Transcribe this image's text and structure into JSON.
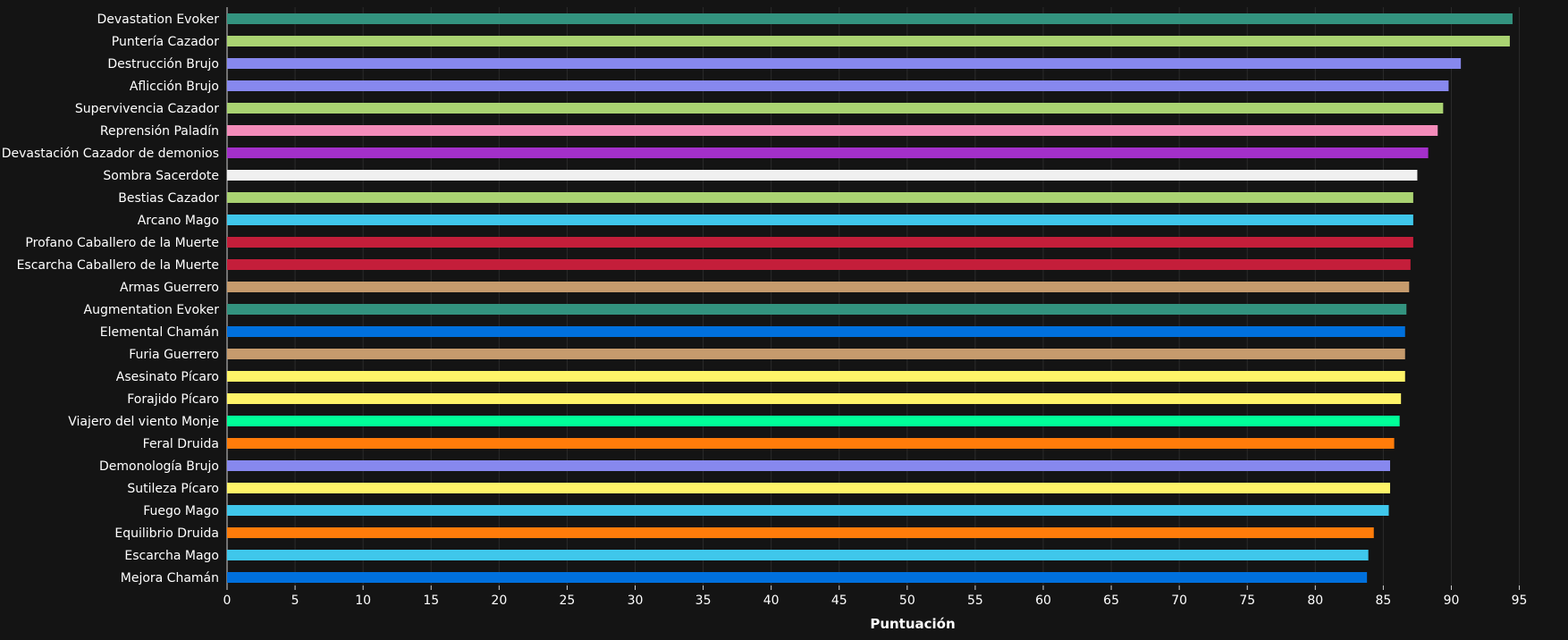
{
  "chart_data": {
    "type": "bar",
    "orientation": "horizontal",
    "title": "",
    "xlabel": "Puntuación",
    "ylabel": "",
    "xlim": [
      0,
      97
    ],
    "xticks": [
      0,
      5,
      10,
      15,
      20,
      25,
      30,
      35,
      40,
      45,
      50,
      55,
      60,
      65,
      70,
      75,
      80,
      85,
      90,
      95
    ],
    "grid": "vertical",
    "background": "#141414",
    "categories": [
      "Devastation Evoker",
      "Puntería Cazador",
      "Destrucción Brujo",
      "Aflicción Brujo",
      "Supervivencia Cazador",
      "Reprensión Paladín",
      "Devastación Cazador de demonios",
      "Sombra Sacerdote",
      "Bestias Cazador",
      "Arcano Mago",
      "Profano Caballero de la Muerte",
      "Escarcha Caballero de la Muerte",
      "Armas Guerrero",
      "Augmentation Evoker",
      "Elemental Chamán",
      "Furia Guerrero",
      "Asesinato Pícaro",
      "Forajido Pícaro",
      "Viajero del viento Monje",
      "Feral Druida",
      "Demonología Brujo",
      "Sutileza Pícaro",
      "Fuego Mago",
      "Equilibrio Druida",
      "Escarcha Mago",
      "Mejora Chamán"
    ],
    "values": [
      94.5,
      94.3,
      90.7,
      89.8,
      89.4,
      89.0,
      88.3,
      87.5,
      87.2,
      87.2,
      87.2,
      87.0,
      86.9,
      86.7,
      86.6,
      86.6,
      86.6,
      86.3,
      86.2,
      85.8,
      85.5,
      85.5,
      85.4,
      84.3,
      83.9,
      83.8
    ],
    "colors": [
      "#33937f",
      "#aad372",
      "#8788ee",
      "#8788ee",
      "#aad372",
      "#f48cba",
      "#a330c9",
      "#f0f0f0",
      "#aad372",
      "#3fc7eb",
      "#c41e3a",
      "#c41e3a",
      "#c69b6d",
      "#33937f",
      "#0070dd",
      "#c69b6d",
      "#fff468",
      "#fff468",
      "#00ff98",
      "#ff7c0a",
      "#8788ee",
      "#fff468",
      "#3fc7eb",
      "#ff7c0a",
      "#3fc7eb",
      "#0070dd"
    ]
  }
}
